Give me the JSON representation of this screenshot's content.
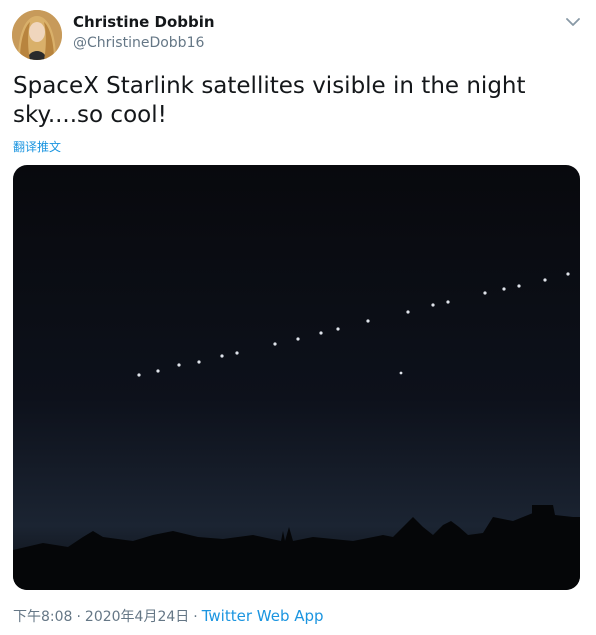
{
  "tweet": {
    "author": {
      "name": "Christine Dobbin",
      "handle": "@ChristineDobb16",
      "avatar_icon": "avatar-photo"
    },
    "text": "SpaceX Starlink satellites visible in the night sky....so cool!",
    "translate_label": "翻译推文",
    "media": {
      "description_icon": "night-sky-photo"
    },
    "time": "下午8:08",
    "date": "2020年4月24日",
    "separator": "·",
    "source_app": "Twitter Web App",
    "caret_icon": "chevron-down-icon"
  },
  "colors": {
    "link": "#1b95e0",
    "secondary_text": "#657786",
    "primary_text": "#14171a"
  }
}
